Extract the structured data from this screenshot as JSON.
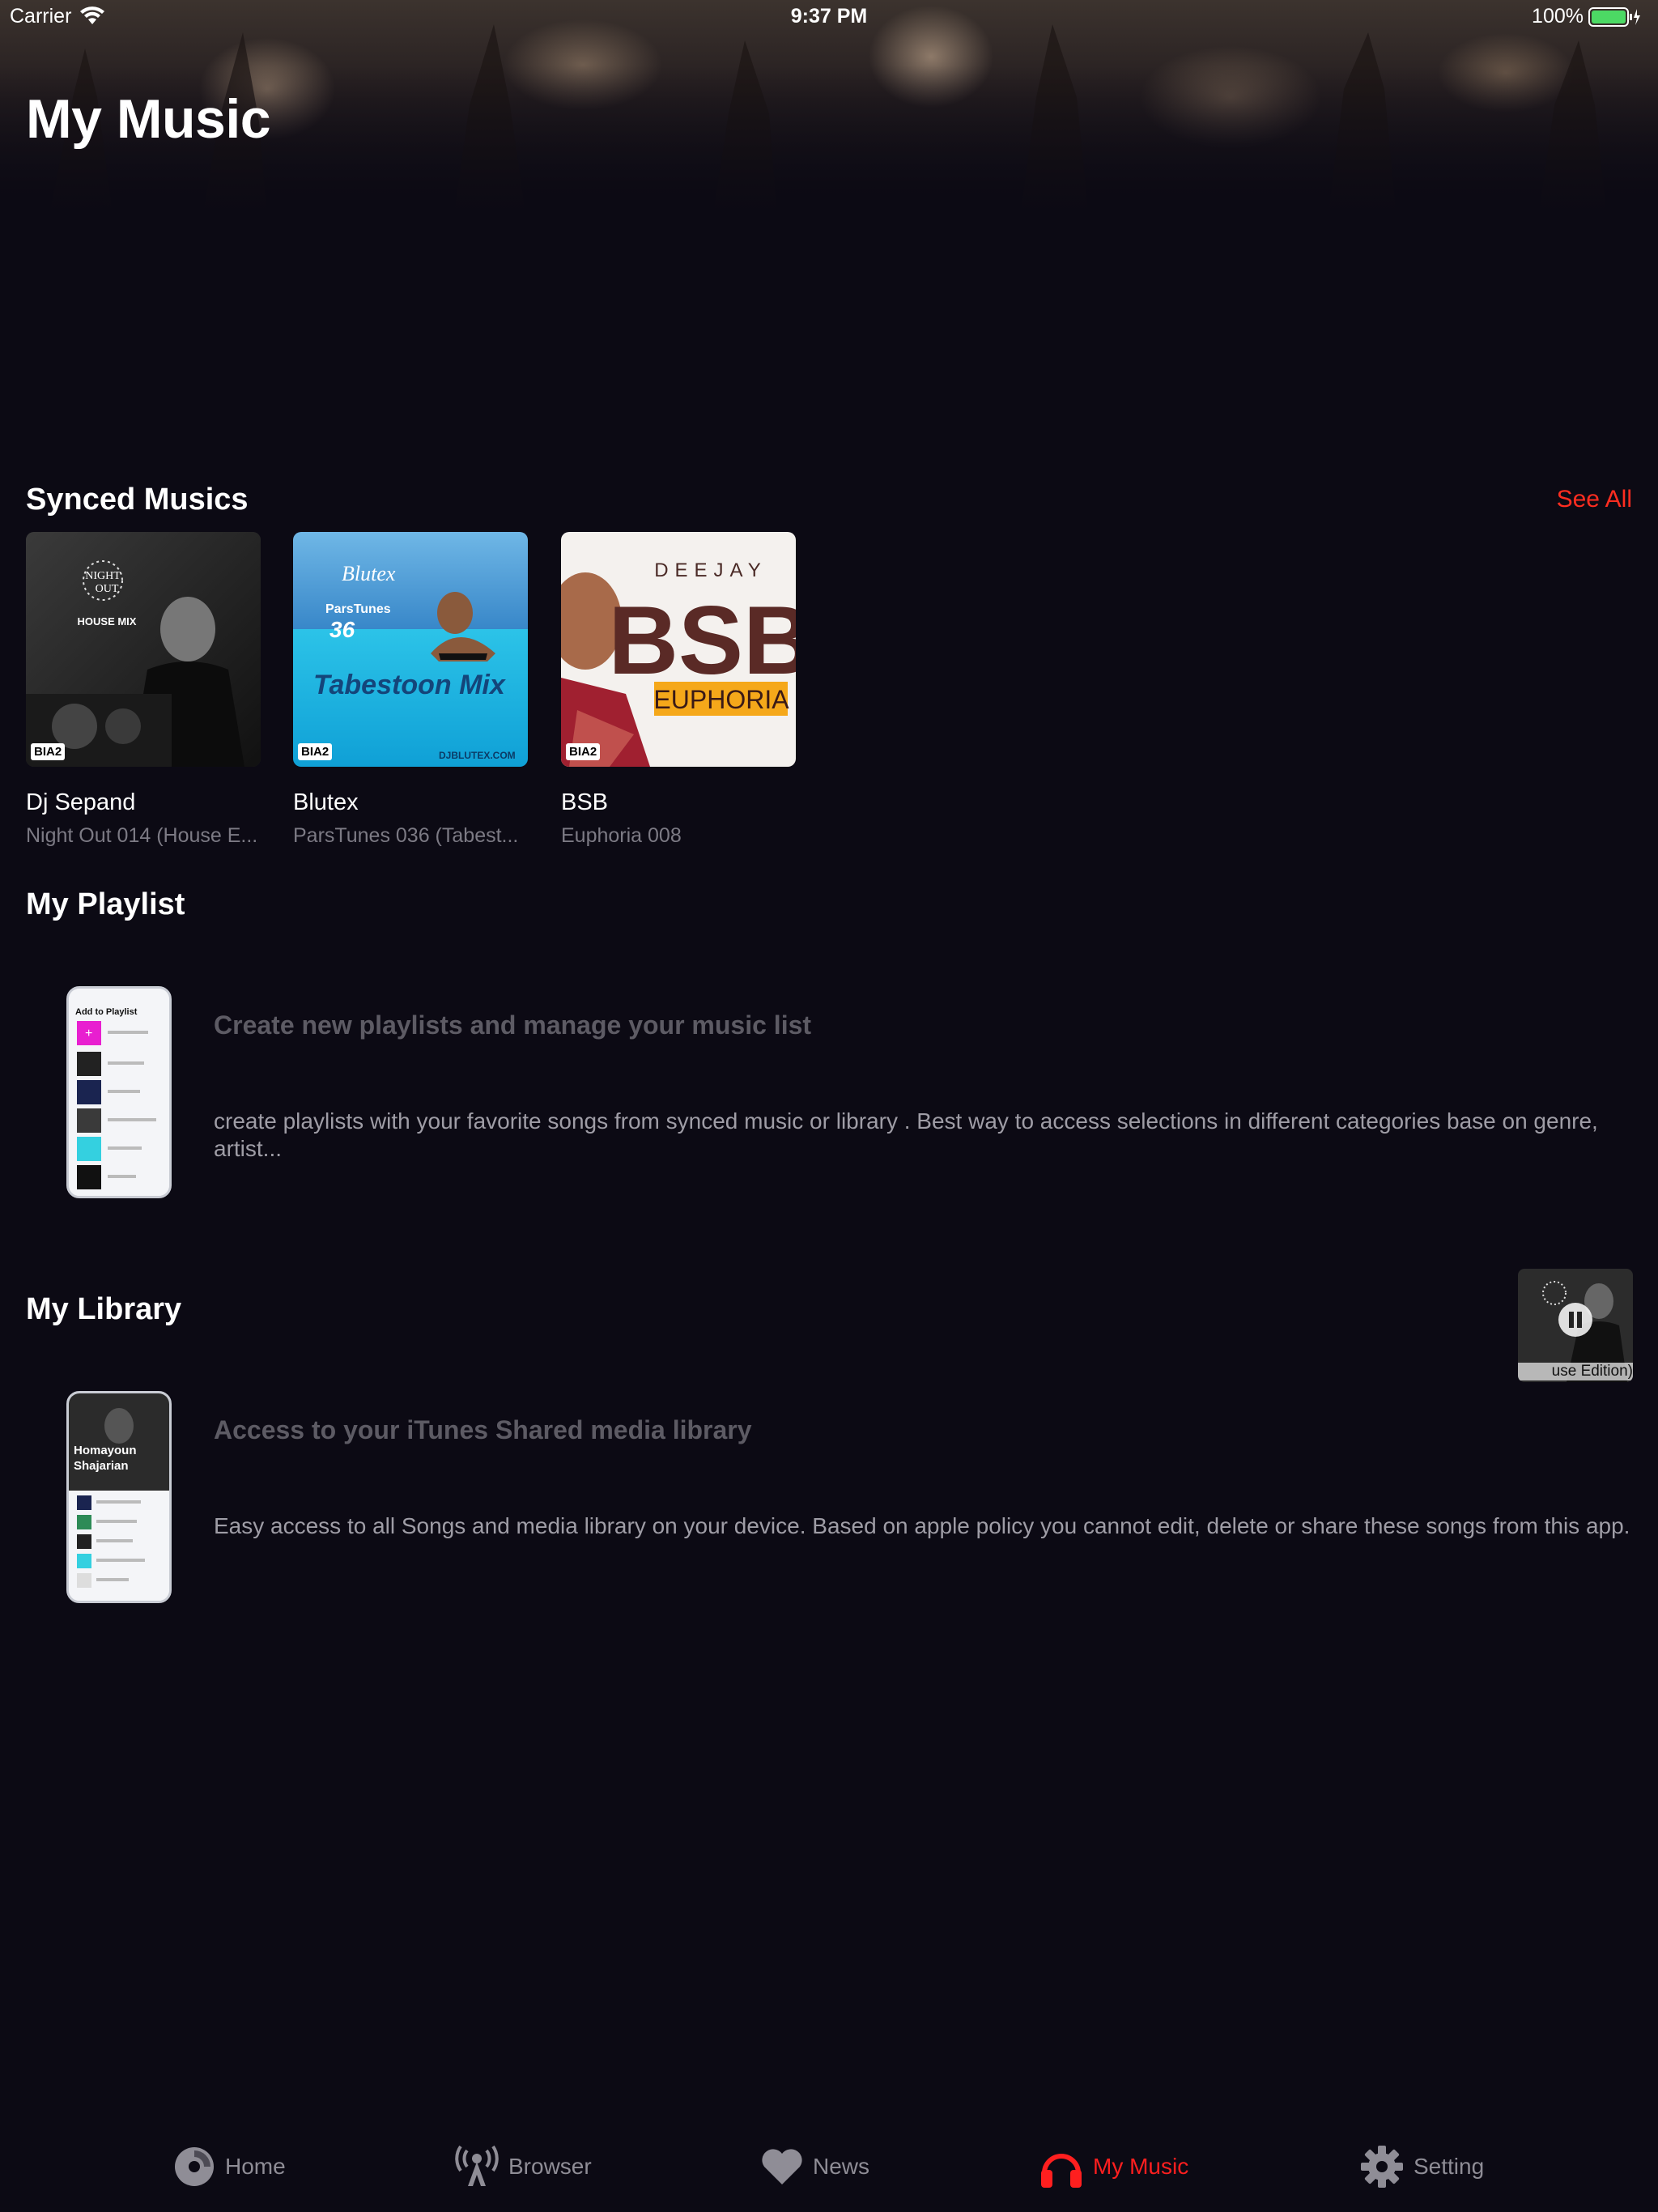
{
  "status_bar": {
    "carrier": "Carrier",
    "time": "9:37 PM",
    "battery": "100%"
  },
  "header": {
    "title": "My Music"
  },
  "synced": {
    "title": "Synced Musics",
    "see_all": "See All",
    "albums": [
      {
        "artist": "Dj Sepand",
        "subtitle": "Night Out 014 (House E...",
        "cover_text_1": "NIGHT",
        "cover_text_2": "OUT",
        "cover_text_3": "HOUSE MIX",
        "badge": "BIA2"
      },
      {
        "artist": "Blutex",
        "subtitle": "ParsTunes 036 (Tabest...",
        "cover_text_1": "Blutex",
        "cover_text_2": "ParsTunes",
        "cover_text_3": "36",
        "cover_text_4": "Tabestoon Mix",
        "cover_text_5": "DJBLUTEX.COM",
        "badge": "BIA2"
      },
      {
        "artist": "BSB",
        "subtitle": "Euphoria 008",
        "cover_text_1": "DEEJAY",
        "cover_text_2": "BSB",
        "cover_text_3": "EUPHORIA",
        "badge": "BIA2"
      }
    ]
  },
  "playlist": {
    "title": "My Playlist",
    "heading": "Create new playlists and manage your music list",
    "description": "create playlists with your favorite songs from synced music or library . Best way to access selections in different categories base on genre, artist...",
    "phone_header": "Add to Playlist"
  },
  "library": {
    "title": "My Library",
    "heading": "Access to your iTunes Shared media library",
    "description": "Easy access to all Songs and media library on your device. Based on apple policy you cannot edit, delete or share these songs from this app.",
    "phone_header": "Homayoun Shajarian"
  },
  "mini_player": {
    "caption": "use Edition)"
  },
  "tabs": [
    {
      "label": "Home",
      "icon": "disc-icon",
      "active": false
    },
    {
      "label": "Browser",
      "icon": "antenna-icon",
      "active": false
    },
    {
      "label": "News",
      "icon": "heart-icon",
      "active": false
    },
    {
      "label": "My Music",
      "icon": "headphones-icon",
      "active": true
    },
    {
      "label": "Setting",
      "icon": "gear-icon",
      "active": false
    }
  ],
  "colors": {
    "background": "#0c0a14",
    "accent": "#ff1f1f",
    "see_all": "#ff2d20",
    "muted_text": "#7c7a84",
    "battery": "#4cd964"
  }
}
